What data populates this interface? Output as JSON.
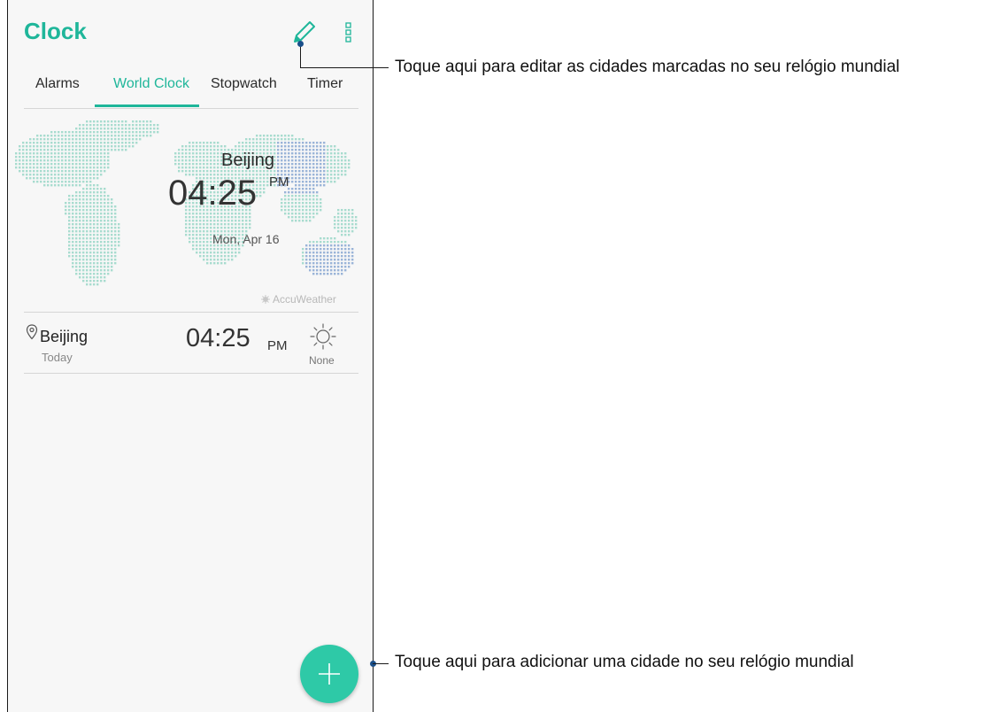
{
  "app": {
    "title": "Clock"
  },
  "toolbar": {
    "edit_icon": "pencil-icon",
    "more_icon": "more-vert-icon"
  },
  "tabs": [
    {
      "label": "Alarms",
      "active": false
    },
    {
      "label": "World Clock",
      "active": true
    },
    {
      "label": "Stopwatch",
      "active": false
    },
    {
      "label": "Timer",
      "active": false
    }
  ],
  "map": {
    "city": "Beijing",
    "time": "04:25",
    "ampm": "PM",
    "date": "Mon, Apr 16",
    "provider": "AccuWeather"
  },
  "cities": [
    {
      "name": "Beijing",
      "day": "Today",
      "time": "04:25",
      "ampm": "PM",
      "weather_icon": "sun-icon",
      "weather_label": "None"
    }
  ],
  "fab": {
    "icon": "plus-icon"
  },
  "callouts": {
    "edit": "Toque aqui para editar as cidades marcadas no seu relógio mundial",
    "add": "Toque aqui para adicionar uma cidade no seu relógio mundial"
  },
  "colors": {
    "accent": "#1fb69a",
    "fab": "#2ec9a7",
    "map_dots": "#a8dccf",
    "map_dots_highlight": "#9ab4d8"
  }
}
